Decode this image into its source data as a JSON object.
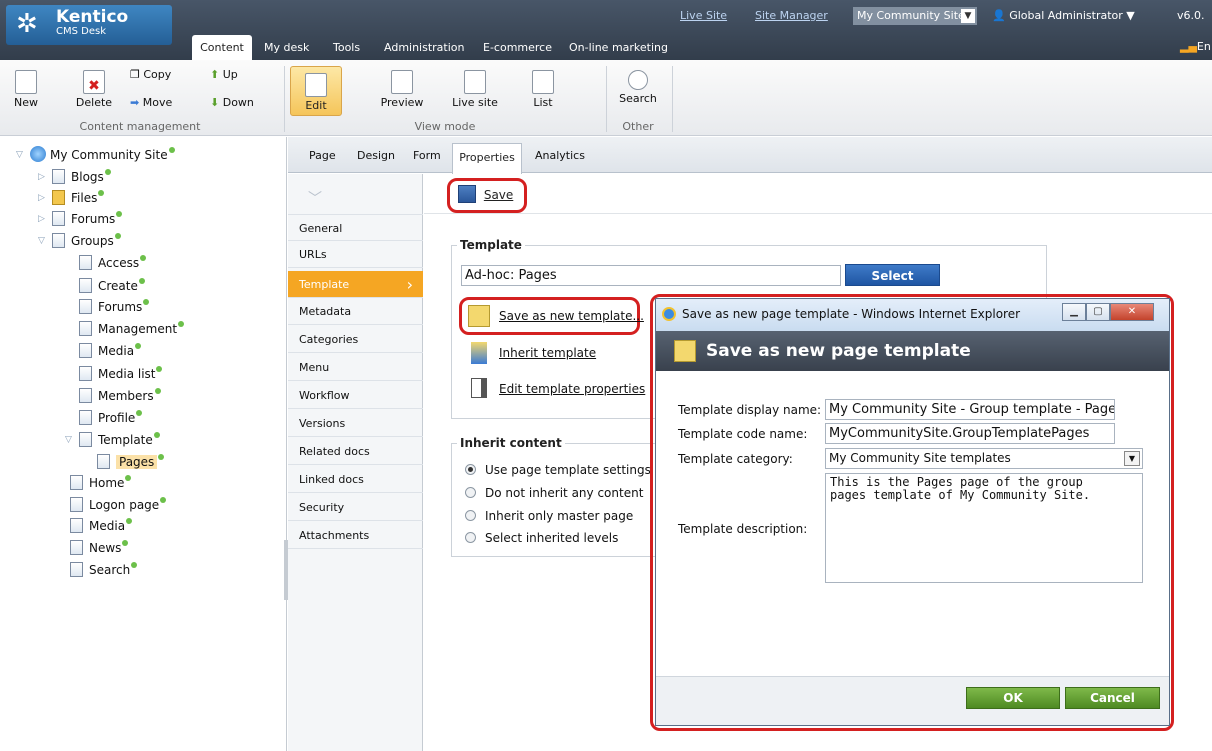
{
  "header": {
    "logo_title": "Kentico",
    "logo_subtitle": "CMS Desk",
    "tabs": [
      "Content",
      "My desk",
      "Tools",
      "Administration",
      "E-commerce",
      "On-line marketing"
    ],
    "live_site": "Live Site",
    "site_manager": "Site Manager",
    "site_selector": "My Community Site",
    "user": "Global Administrator",
    "version": "v6.0.",
    "language": "En"
  },
  "toolbar": {
    "new": "New",
    "delete": "Delete",
    "copy": "Copy",
    "move": "Move",
    "up": "Up",
    "down": "Down",
    "group_content": "Content management",
    "edit": "Edit",
    "preview": "Preview",
    "live_site": "Live site",
    "list": "List",
    "group_view": "View mode",
    "search": "Search",
    "group_other": "Other"
  },
  "tree": {
    "root": "My Community Site",
    "blogs": "Blogs",
    "files": "Files",
    "forums": "Forums",
    "groups": "Groups",
    "access": "Access",
    "create": "Create",
    "forums2": "Forums",
    "management": "Management",
    "media": "Media",
    "media_list": "Media list",
    "members": "Members",
    "profile": "Profile",
    "template": "Template",
    "pages": "Pages",
    "home": "Home",
    "logon": "Logon page",
    "media2": "Media",
    "news": "News",
    "search": "Search"
  },
  "page_tabs": {
    "page": "Page",
    "design": "Design",
    "form": "Form",
    "properties": "Properties",
    "analytics": "Analytics"
  },
  "vmenu": {
    "general": "General",
    "urls": "URLs",
    "template": "Template",
    "metadata": "Metadata",
    "categories": "Categories",
    "menu": "Menu",
    "workflow": "Workflow",
    "versions": "Versions",
    "related": "Related docs",
    "linked": "Linked docs",
    "security": "Security",
    "attachments": "Attachments"
  },
  "content": {
    "save": "Save",
    "template_legend": "Template",
    "template_value": "Ad-hoc: Pages",
    "select": "Select",
    "save_as_new": "Save as new template...",
    "inherit_template": "Inherit template",
    "edit_props": "Edit template properties",
    "inherit_legend": "Inherit content",
    "radio1": "Use page template settings",
    "radio2": "Do not inherit any content",
    "radio3": "Inherit only master page",
    "radio4": "Select inherited levels"
  },
  "dialog": {
    "window_title": "Save as new page template - Windows Internet Explorer",
    "heading": "Save as new page template",
    "display_name_label": "Template display name:",
    "display_name_value": "My Community Site - Group template - Pages",
    "code_name_label": "Template code name:",
    "code_name_value": "MyCommunitySite.GroupTemplatePages",
    "category_label": "Template category:",
    "category_value": "My Community Site templates",
    "description_label": "Template description:",
    "description_value": "This is the Pages page of the group pages template of My Community Site.",
    "ok": "OK",
    "cancel": "Cancel"
  }
}
